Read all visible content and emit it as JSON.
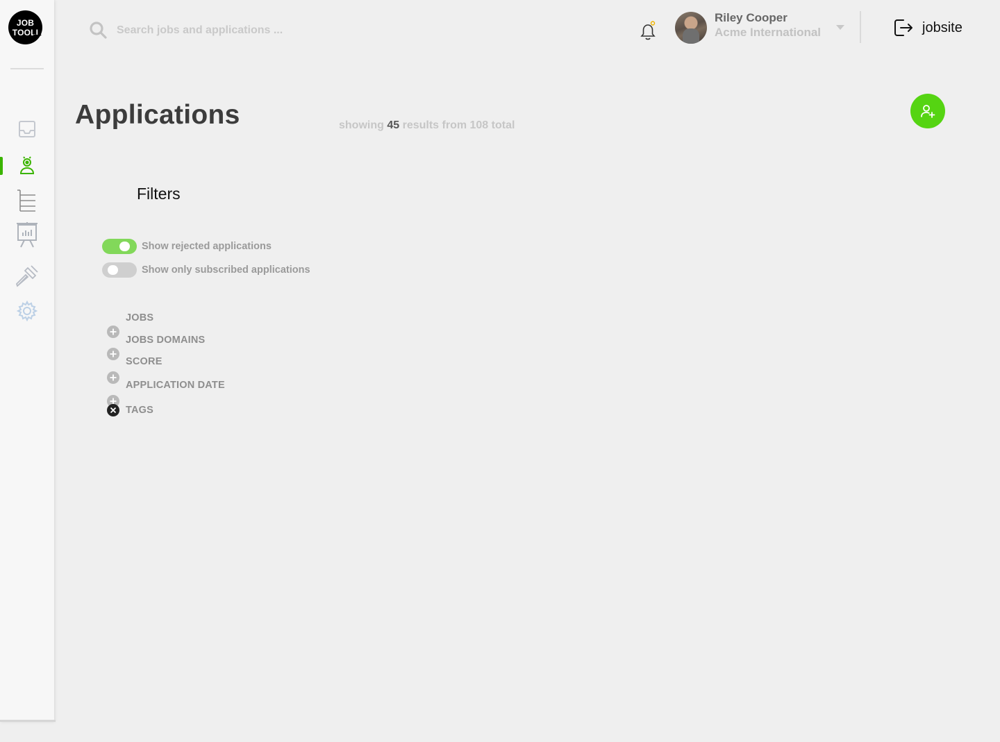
{
  "logo": {
    "line1": "JOB",
    "line2": "TOOLI"
  },
  "sidebar": {
    "items": [
      {
        "name": "inbox-icon",
        "active": false
      },
      {
        "name": "applicants-icon",
        "active": true
      },
      {
        "name": "list-tree-icon",
        "active": false
      },
      {
        "name": "presentation-chart-icon",
        "active": false
      },
      {
        "name": "tools-icon",
        "active": false
      },
      {
        "name": "settings-gear-icon",
        "active": false
      }
    ],
    "accent": "#3bb400"
  },
  "header": {
    "search_placeholder": "Search jobs and applications ...",
    "user": {
      "name": "Riley Cooper",
      "company": "Acme International"
    },
    "jobsite_label": "jobsite",
    "notification_dot_color": "#f0b400"
  },
  "main": {
    "title": "Applications",
    "results": {
      "prefix": "showing",
      "count": "45",
      "suffix": "results from 108 total"
    },
    "add_button_color": "#55d412"
  },
  "filters": {
    "title": "Filters",
    "toggles": [
      {
        "label": "Show rejected applications",
        "on": true
      },
      {
        "label": "Show only subscribed applications",
        "on": false
      }
    ],
    "groups": [
      "JOBS",
      "JOBS DOMAINS",
      "SCORE",
      "APPLICATION DATE",
      "TAGS"
    ]
  }
}
